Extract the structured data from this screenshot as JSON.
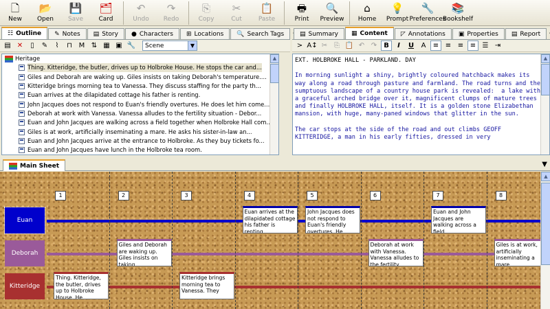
{
  "toolbar": {
    "buttons": [
      {
        "label": "New",
        "icon": "new-document-icon",
        "enabled": true
      },
      {
        "label": "Open",
        "icon": "open-folder-icon",
        "enabled": true
      },
      {
        "label": "Save",
        "icon": "save-disk-icon",
        "enabled": false
      },
      {
        "label": "Card",
        "icon": "index-card-icon",
        "enabled": true
      },
      {
        "label": "Undo",
        "icon": "undo-icon",
        "enabled": false
      },
      {
        "label": "Redo",
        "icon": "redo-icon",
        "enabled": false
      },
      {
        "label": "Copy",
        "icon": "copy-icon",
        "enabled": false
      },
      {
        "label": "Cut",
        "icon": "scissors-icon",
        "enabled": false
      },
      {
        "label": "Paste",
        "icon": "paste-clipboard-icon",
        "enabled": false
      },
      {
        "label": "Print",
        "icon": "printer-icon",
        "enabled": true
      },
      {
        "label": "Preview",
        "icon": "magnifier-icon",
        "enabled": true
      },
      {
        "label": "Home",
        "icon": "house-icon",
        "enabled": true
      },
      {
        "label": "Prompt",
        "icon": "lightbulb-icon",
        "enabled": true
      },
      {
        "label": "Preferences",
        "icon": "wrench-icon",
        "enabled": true
      },
      {
        "label": "Bookshelf",
        "icon": "books-icon",
        "enabled": true
      }
    ]
  },
  "left_tabs": [
    {
      "label": "Outline",
      "icon": "outline-icon",
      "active": true
    },
    {
      "label": "Notes",
      "icon": "pencil-icon",
      "active": false
    },
    {
      "label": "Story",
      "icon": "page-icon",
      "active": false
    },
    {
      "label": "Characters",
      "icon": "dot-icon",
      "active": false
    },
    {
      "label": "Locations",
      "icon": "map-icon",
      "active": false
    },
    {
      "label": "Search Tags",
      "icon": "search-icon",
      "active": false
    }
  ],
  "outline_toolbar": {
    "filter_value": "Scene"
  },
  "outline": {
    "root": "Heritage",
    "items": [
      "Thing. Kitteridge, the butler, drives up to Holbroke House. He stops the car and...",
      "Giles and Deborah are waking up.  Giles insists on taking Deborah's temperature....",
      "Kitteridge brings morning tea to Vanessa. They discuss staffing for the party th...",
      "Euan arrives at the dilapidated cottage his father is renting.",
      "John Jacques does not respond to Euan's friendly overtures. He does let him come...",
      "Deborah at work with Vanessa. Vanessa alludes to the fertility situation - Debor...",
      "Euan and John Jacques are walking across a field together when Holbroke Hall com...",
      "Giles is at work, artificially inseminating a mare. He asks his sister-in-law an...",
      "Euan and John Jacques arrive at the entrance to Holbroke. As they buy tickets fo...",
      "Euan and John Jacques have lunch in the Holbroke tea room."
    ]
  },
  "right_tabs": [
    {
      "label": "Summary",
      "icon": "summary-icon",
      "active": false
    },
    {
      "label": "Content",
      "icon": "content-icon",
      "active": true
    },
    {
      "label": "Annotations",
      "icon": "annotation-icon",
      "active": false
    },
    {
      "label": "Properties",
      "icon": "properties-icon",
      "active": false
    },
    {
      "label": "Report",
      "icon": "report-icon",
      "active": false
    }
  ],
  "content": {
    "heading": "EXT. HOLBROKE HALL - PARKLAND. DAY",
    "para1": "In morning sunlight a shiny, brightly coloured hatchback makes its way along a road through pasture and farmland. The road turns and the sumptuous landscape of a country house park is revealed:  a lake with a graceful arched bridge over it, magnificent clumps of mature trees and finally HOLBROKE HALL, itself. It is a golden stone Elizabethan mansion, with huge, many-paned windows that glitter in the sun.",
    "para2": "The car stops at the side of the road and out climbs GEOFF KITTERIDGE, a man in his early fifties, dressed in very"
  },
  "main_sheet": {
    "tab_label": "Main Sheet",
    "columns": [
      "1",
      "2",
      "3",
      "4",
      "5",
      "6",
      "7",
      "8"
    ],
    "characters": [
      {
        "name": "Euan",
        "color": "#0000cc"
      },
      {
        "name": "Deborah",
        "color": "#9a5a9a"
      },
      {
        "name": "Kitteridge",
        "color": "#a83030"
      }
    ],
    "cards": [
      {
        "text": "Euan arrives at the dilapidated cottage his father is renting.",
        "col": 4,
        "row": 0,
        "border": "#0000aa"
      },
      {
        "text": "John Jacques does not respond to Euan's friendly overtures. He",
        "col": 5,
        "row": 0,
        "border": "#0000aa"
      },
      {
        "text": "Euan and John Jacques are walking across a field",
        "col": 7,
        "row": 0,
        "border": "#0000aa"
      },
      {
        "text": "Giles and Deborah are waking up. Giles insists on taking",
        "col": 2,
        "row": 1,
        "border": "#9a5a9a"
      },
      {
        "text": "Deborah at work with Vanessa. Vanessa alludes to the fertility",
        "col": 6,
        "row": 1,
        "border": "#9a5a9a"
      },
      {
        "text": "Giles is at work, artificially inseminating a mare.",
        "col": 8,
        "row": 1,
        "border": "#9a5a9a"
      },
      {
        "text": "Thing. Kitteridge, the butler, drives up to Holbroke House. He",
        "col": 1,
        "row": 2,
        "border": "#a83030"
      },
      {
        "text": "Kitteridge brings morning tea to Vanessa. They",
        "col": 3,
        "row": 2,
        "border": "#a83030"
      }
    ]
  }
}
